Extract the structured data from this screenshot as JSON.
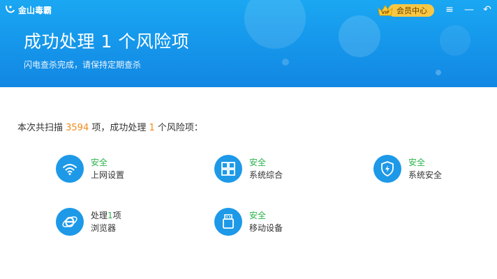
{
  "app": {
    "name": "金山毒霸"
  },
  "header": {
    "title": "成功处理 1 个风险项",
    "subtitle": "闪电查杀完成，请保持定期查杀",
    "vip_badge": "VIP",
    "member_center": "会员中心",
    "menu_icon": "≡",
    "minimize_icon": "—",
    "back_icon": "↶"
  },
  "summary": {
    "prefix": "本次共扫描 ",
    "scanned": "3594",
    "mid": " 项，成功处理 ",
    "handled": "1",
    "suffix": " 个风险项："
  },
  "items": [
    {
      "status": "安全",
      "label": "上网设置",
      "icon": "wifi-icon"
    },
    {
      "status": "安全",
      "label": "系统综合",
      "icon": "windows-icon"
    },
    {
      "status": "安全",
      "label": "系统安全",
      "icon": "shield-lightning-icon"
    },
    {
      "status_prefix": "处理",
      "status_count": "1",
      "status_suffix": "项",
      "label": "浏览器",
      "icon": "browser-ie-icon"
    },
    {
      "status": "安全",
      "label": "移动设备",
      "icon": "usb-device-icon"
    }
  ],
  "colors": {
    "header_blue": "#1595ea",
    "safe_green": "#29b34a",
    "number_orange": "#f08a1c",
    "icon_blue": "#1d99e8",
    "vip_gold": "#f7c744"
  }
}
